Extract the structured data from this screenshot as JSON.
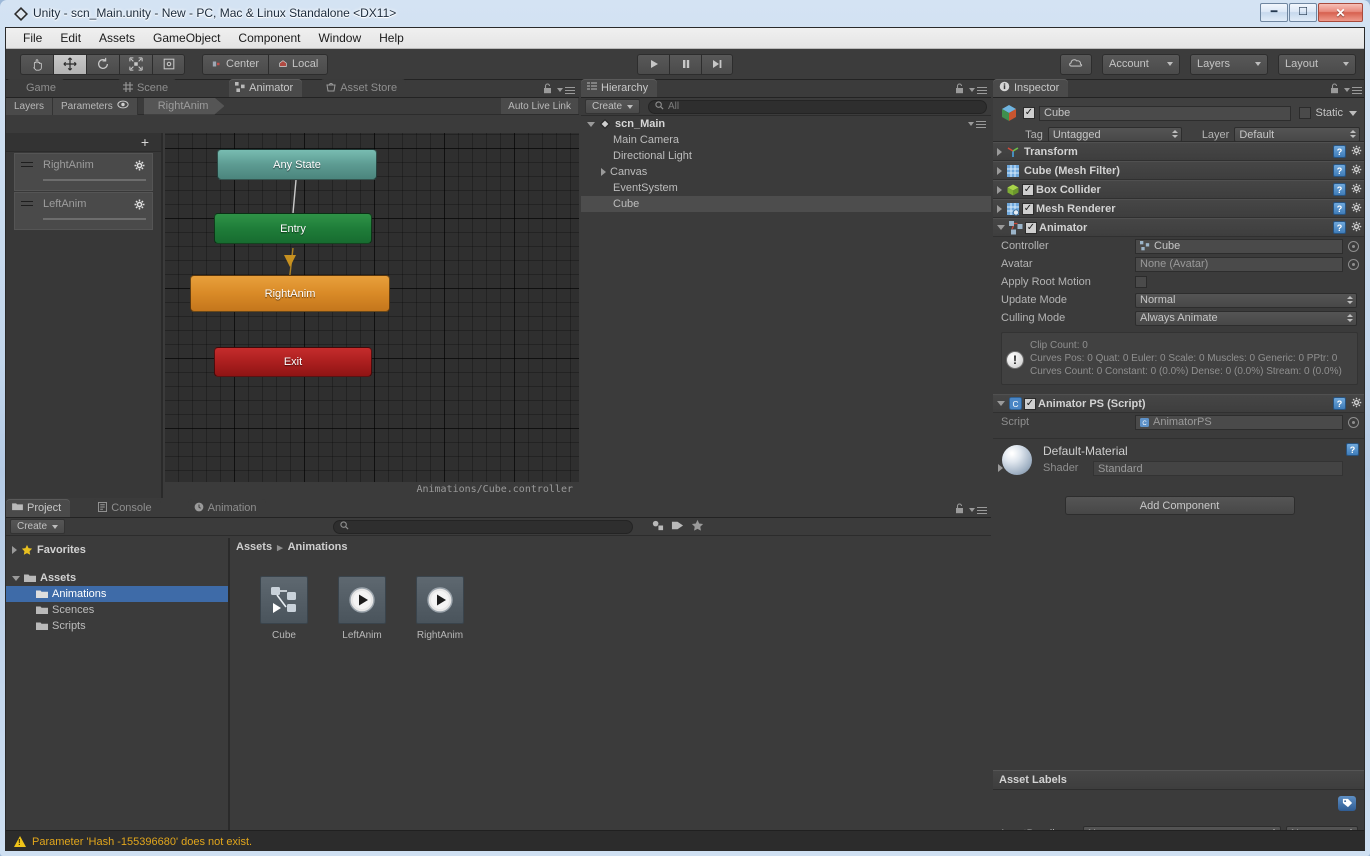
{
  "window": {
    "title": "Unity - scn_Main.unity - New - PC, Mac & Linux Standalone <DX11>",
    "minimize": "–",
    "maximize": "❐",
    "close": "✕"
  },
  "menubar": {
    "items": [
      "File",
      "Edit",
      "Assets",
      "GameObject",
      "Component",
      "Window",
      "Help"
    ]
  },
  "toolbar": {
    "tools": [
      "hand-tool",
      "move-tool",
      "rotate-tool",
      "scale-tool",
      "rect-tool"
    ],
    "active_tool_index": 1,
    "pivot": {
      "center_label": "Center",
      "local_label": "Local"
    },
    "play_label": "▶",
    "pause_label": "❚❚",
    "step_label": "▶❚",
    "cloud_label": "cloud-icon",
    "account_label": "Account",
    "layers_label": "Layers",
    "layout_label": "Layout"
  },
  "animator": {
    "tabs": [
      {
        "label": "Game",
        "icon": "game-icon",
        "active": false
      },
      {
        "label": "Scene",
        "icon": "scene-icon",
        "active": false
      },
      {
        "label": "Animator",
        "icon": "animator-icon",
        "active": true
      },
      {
        "label": "Asset Store",
        "icon": "asset-store-icon",
        "active": false
      }
    ],
    "subbar": {
      "layers_btn": "Layers",
      "parameters_btn": "Parameters",
      "breadcrumb": "RightAnim",
      "auto_live_link": "Auto Live Link"
    },
    "layers_pane": {
      "add_label": "+",
      "layers": [
        {
          "name": "RightAnim"
        },
        {
          "name": "LeftAnim"
        }
      ]
    },
    "graph": {
      "nodes": [
        {
          "label": "Any State",
          "type": "any"
        },
        {
          "label": "Entry",
          "type": "entry"
        },
        {
          "label": "RightAnim",
          "type": "state"
        },
        {
          "label": "Exit",
          "type": "exit"
        }
      ],
      "footer": "Animations/Cube.controller"
    }
  },
  "hierarchy": {
    "tab_label": "Hierarchy",
    "create_label": "Create",
    "search_placeholder": "All",
    "rows": [
      {
        "label": "scn_Main",
        "depth": 0,
        "type": "scene",
        "expanded": true,
        "selected": false
      },
      {
        "label": "Main Camera",
        "depth": 1,
        "type": "object",
        "selected": false
      },
      {
        "label": "Directional Light",
        "depth": 1,
        "type": "object",
        "selected": false
      },
      {
        "label": "Canvas",
        "depth": 1,
        "type": "object",
        "collapsed": true,
        "selected": false
      },
      {
        "label": "EventSystem",
        "depth": 1,
        "type": "object",
        "selected": false
      },
      {
        "label": "Cube",
        "depth": 1,
        "type": "object",
        "selected": true
      }
    ]
  },
  "inspector": {
    "tab_label": "Inspector",
    "object_name": "Cube",
    "static_label": "Static",
    "tag_label": "Tag",
    "tag_value": "Untagged",
    "layer_label": "Layer",
    "layer_value": "Default",
    "components": [
      {
        "name": "Transform",
        "icon": "transform-icon",
        "has_checkbox": false,
        "expanded": false
      },
      {
        "name": "Cube (Mesh Filter)",
        "icon": "mesh-filter-icon",
        "has_checkbox": false,
        "expanded": false
      },
      {
        "name": "Box Collider",
        "icon": "box-collider-icon",
        "has_checkbox": true,
        "checked": true,
        "expanded": false
      },
      {
        "name": "Mesh Renderer",
        "icon": "mesh-renderer-icon",
        "has_checkbox": true,
        "checked": true,
        "expanded": false
      },
      {
        "name": "Animator",
        "icon": "animator-icon",
        "has_checkbox": true,
        "checked": true,
        "expanded": true
      }
    ],
    "animator": {
      "controller_label": "Controller",
      "controller_value": "Cube",
      "avatar_label": "Avatar",
      "avatar_value": "None (Avatar)",
      "apply_root_motion_label": "Apply Root Motion",
      "apply_root_motion_checked": false,
      "update_mode_label": "Update Mode",
      "update_mode_value": "Normal",
      "culling_mode_label": "Culling Mode",
      "culling_mode_value": "Always Animate",
      "info_lines": [
        "Clip Count: 0",
        "Curves Pos: 0 Quat: 0 Euler: 0 Scale: 0 Muscles: 0 Generic: 0 PPtr: 0",
        "Curves Count: 0 Constant: 0 (0.0%) Dense: 0 (0.0%) Stream: 0 (0.0%)"
      ]
    },
    "script_component": {
      "name": "Animator PS (Script)",
      "checked": true,
      "script_label": "Script",
      "script_value": "AnimatorPS"
    },
    "material": {
      "name": "Default-Material",
      "shader_label": "Shader",
      "shader_value": "Standard"
    },
    "add_component_label": "Add Component",
    "asset_labels_title": "Asset Labels",
    "assetbundle_label": "AssetBundle",
    "assetbundle_value": "None",
    "assetbundle_variant": "None"
  },
  "project": {
    "tabs": [
      {
        "label": "Project",
        "icon": "folder-icon",
        "active": true
      },
      {
        "label": "Console",
        "icon": "console-icon",
        "active": false
      },
      {
        "label": "Animation",
        "icon": "clock-icon",
        "active": false
      }
    ],
    "create_label": "Create",
    "search_placeholder": "",
    "tree": [
      {
        "label": "Favorites",
        "type": "favorites",
        "depth": 0,
        "selected": false
      },
      {
        "label": "Assets",
        "type": "folder",
        "depth": 0,
        "selected": false
      },
      {
        "label": "Animations",
        "type": "folder",
        "depth": 1,
        "selected": true
      },
      {
        "label": "Scences",
        "type": "folder",
        "depth": 1,
        "selected": false
      },
      {
        "label": "Scripts",
        "type": "folder",
        "depth": 1,
        "selected": false
      }
    ],
    "breadcrumb": [
      "Assets",
      "Animations"
    ],
    "assets": [
      {
        "name": "Cube",
        "icon": "animator-controller-icon"
      },
      {
        "name": "LeftAnim",
        "icon": "animation-clip-icon"
      },
      {
        "name": "RightAnim",
        "icon": "animation-clip-icon"
      }
    ]
  },
  "statusbar": {
    "message": "Parameter 'Hash -155396680' does not exist."
  },
  "colors": {
    "accent_selection": "#3e6ba8",
    "warning": "#e2a61c",
    "state_node": "#d98a27",
    "entry_node": "#1f7d39",
    "exit_node": "#ab1f1f",
    "any_state_node": "#5d9b92"
  }
}
